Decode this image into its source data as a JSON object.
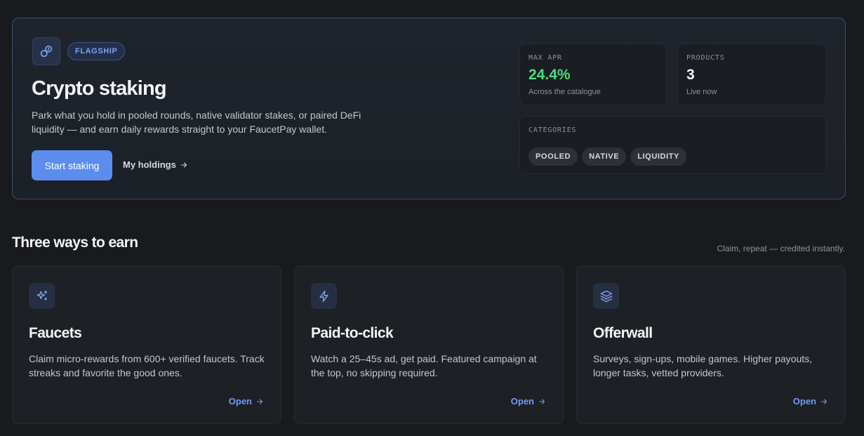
{
  "hero": {
    "icon": "link-coin-icon",
    "badge": "FLAGSHIP",
    "title": "Crypto staking",
    "description": "Park what you hold in pooled rounds, native validator stakes, or paired DeFi liquidity — and earn daily rewards straight to your FaucetPay wallet.",
    "primary_button": "Start staking",
    "secondary_link": "My holdings"
  },
  "stats": {
    "max_apr": {
      "label": "MAX APR",
      "value": "24.4%",
      "sub": "Across the catalogue",
      "color": "#4ade80"
    },
    "products": {
      "label": "PRODUCTS",
      "value": "3",
      "sub": "Live now",
      "color": "#f2f4f7"
    }
  },
  "categories": {
    "label": "CATEGORIES",
    "items": [
      "POOLED",
      "NATIVE",
      "LIQUIDITY"
    ]
  },
  "section": {
    "title": "Three ways to earn",
    "subtitle": "Claim, repeat — credited instantly."
  },
  "cards": [
    {
      "icon": "sparkles-icon",
      "title": "Faucets",
      "description": "Claim micro-rewards from 600+ verified faucets. Track streaks and favorite the good ones.",
      "link": "Open"
    },
    {
      "icon": "lightning-icon",
      "title": "Paid-to-click",
      "description": "Watch a 25–45s ad, get paid. Featured campaign at the top, no skipping required.",
      "link": "Open"
    },
    {
      "icon": "layers-icon",
      "title": "Offerwall",
      "description": "Surveys, sign-ups, mobile games. Higher payouts, longer tasks, vetted providers.",
      "link": "Open"
    }
  ],
  "colors": {
    "accent": "#5b8def",
    "positive": "#4ade80",
    "link": "#6f9cf0"
  }
}
